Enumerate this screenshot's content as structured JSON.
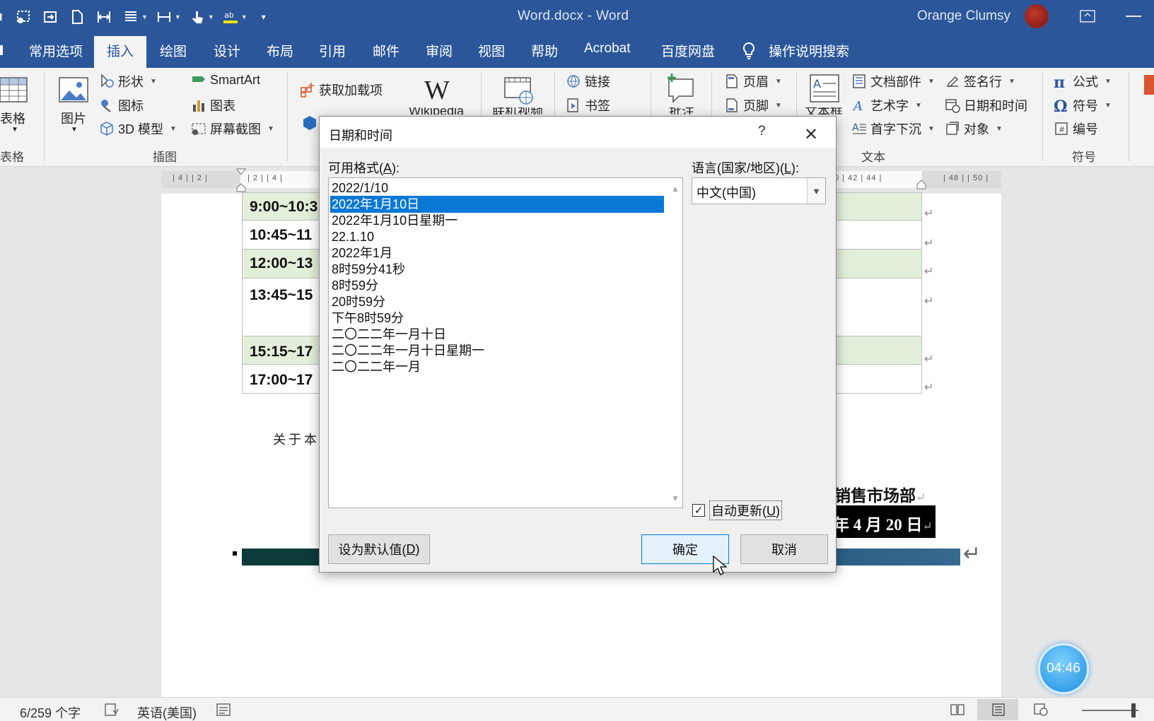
{
  "window": {
    "title": "Word.docx  -  Word",
    "user_name": "Orange Clumsy"
  },
  "tabs": [
    {
      "label": "常用选项"
    },
    {
      "label": "插入"
    },
    {
      "label": "绘图"
    },
    {
      "label": "设计"
    },
    {
      "label": "布局"
    },
    {
      "label": "引用"
    },
    {
      "label": "邮件"
    },
    {
      "label": "审阅"
    },
    {
      "label": "视图"
    },
    {
      "label": "帮助"
    },
    {
      "label": "Acrobat"
    },
    {
      "label": "百度网盘"
    },
    {
      "label": "操作说明搜索"
    }
  ],
  "ribbon": {
    "table": "表格",
    "pictures": "图片",
    "shapes": "形状",
    "icons": "图标",
    "models3d": "3D 模型",
    "smartart": "SmartArt",
    "chart": "图表",
    "screenshot": "屏幕截图",
    "get_addins": "获取加载项",
    "wikipedia": "Wikipedia",
    "online_video": "联机视频",
    "link": "链接",
    "bookmark": "书签",
    "comment": "批注",
    "header": "页眉",
    "footer": "页脚",
    "textbox": "文本框",
    "quick_parts": "文档部件",
    "wordart": "艺术字",
    "dropcap": "首字下沉",
    "signature": "签名行",
    "date_time": "日期和时间",
    "object": "对象",
    "equation": "公式",
    "symbol": "符号",
    "number": "编号",
    "groups": {
      "tables": "表格",
      "illustrations": "插图",
      "text": "文本",
      "symbols": "符号"
    }
  },
  "ruler": {
    "left_ticks": "| 4 |   | 2 |",
    "mid_ticks": "|  2 |   | 4 |",
    "right_ticks": "0 |   42 |   44 |",
    "far_right_ticks": "| 48 |   | 50 |"
  },
  "document": {
    "rows": [
      {
        "time": "9:00~10:3"
      },
      {
        "time": "10:45~11"
      },
      {
        "time": "12:00~13"
      },
      {
        "time": "13:45~15"
      },
      {
        "time": "15:15~17"
      },
      {
        "time": "17:00~17"
      }
    ],
    "about_text": "关于本",
    "dept_text": "销售市场部",
    "date_text": "年 4 月 20 日"
  },
  "dialog": {
    "title": "日期和时间",
    "help": "?",
    "close": "✕",
    "formats_label_pre": "可用格式(",
    "formats_label_key": "A",
    "formats_label_post": "):",
    "language_label_pre": "语言(国家/地区)(",
    "language_label_key": "L",
    "language_label_post": "):",
    "formats": [
      "2022/1/10",
      "2022年1月10日",
      "2022年1月10日星期一",
      "22.1.10",
      "2022年1月",
      "8时59分41秒",
      "8时59分",
      "20时59分",
      "下午8时59分",
      "二〇二二年一月十日",
      "二〇二二年一月十日星期一",
      "二〇二二年一月"
    ],
    "selected_index": 1,
    "language_value": "中文(中国)",
    "auto_update_pre": "自动更新(",
    "auto_update_key": "U",
    "auto_update_post": ")",
    "auto_update_checked": true,
    "set_default_pre": "设为默认值(",
    "set_default_key": "D",
    "set_default_post": ")",
    "ok_label": "确定",
    "cancel_label": "取消"
  },
  "timer": "04:46",
  "status": {
    "word_count": "6/259 个字",
    "language": "英语(美国)"
  }
}
